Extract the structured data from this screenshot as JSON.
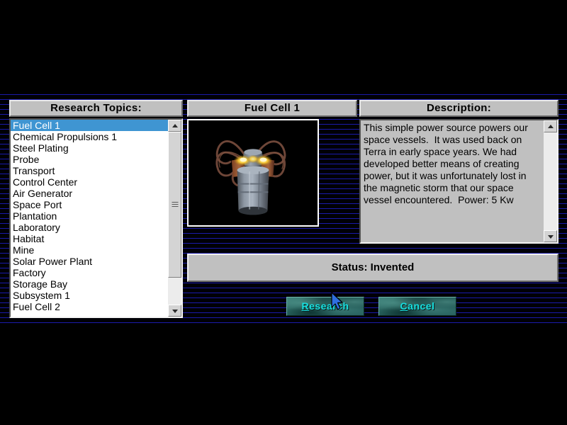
{
  "dialog": {
    "panels": {
      "topics_title": "Research Topics:",
      "preview_title": "Fuel Cell 1",
      "description_title": "Description:"
    },
    "topics": [
      {
        "label": "Fuel Cell 1",
        "selected": true
      },
      {
        "label": "Chemical Propulsions 1",
        "selected": false
      },
      {
        "label": "Steel Plating",
        "selected": false
      },
      {
        "label": "Probe",
        "selected": false
      },
      {
        "label": "Transport",
        "selected": false
      },
      {
        "label": "Control Center",
        "selected": false
      },
      {
        "label": "Air Generator",
        "selected": false
      },
      {
        "label": "Space Port",
        "selected": false
      },
      {
        "label": "Plantation",
        "selected": false
      },
      {
        "label": "Laboratory",
        "selected": false
      },
      {
        "label": "Habitat",
        "selected": false
      },
      {
        "label": "Mine",
        "selected": false
      },
      {
        "label": "Solar Power Plant",
        "selected": false
      },
      {
        "label": "Factory",
        "selected": false
      },
      {
        "label": "Storage Bay",
        "selected": false
      },
      {
        "label": "Subsystem 1",
        "selected": false
      },
      {
        "label": "Fuel Cell 2",
        "selected": false
      }
    ],
    "description_text": "This simple power source powers our space vessels.  It was used back on Terra in early space years. We had developed better means of creating power, but it was unfortunately lost in the magnetic storm that our space vessel encountered.  Power: 5 Kw",
    "status": "Status: Invented",
    "buttons": {
      "research": {
        "accel": "R",
        "rest": "esearch"
      },
      "cancel": {
        "accel": "C",
        "rest": "ancel"
      }
    },
    "preview_alt": "fuel-cell-render"
  },
  "colors": {
    "selection_blue": "#3f95d2",
    "panel_face": "#c0c0c0",
    "button_text_cyan": "#18e0e0",
    "scanline_blue": "#1a1aa8",
    "backdrop": "#000000"
  }
}
